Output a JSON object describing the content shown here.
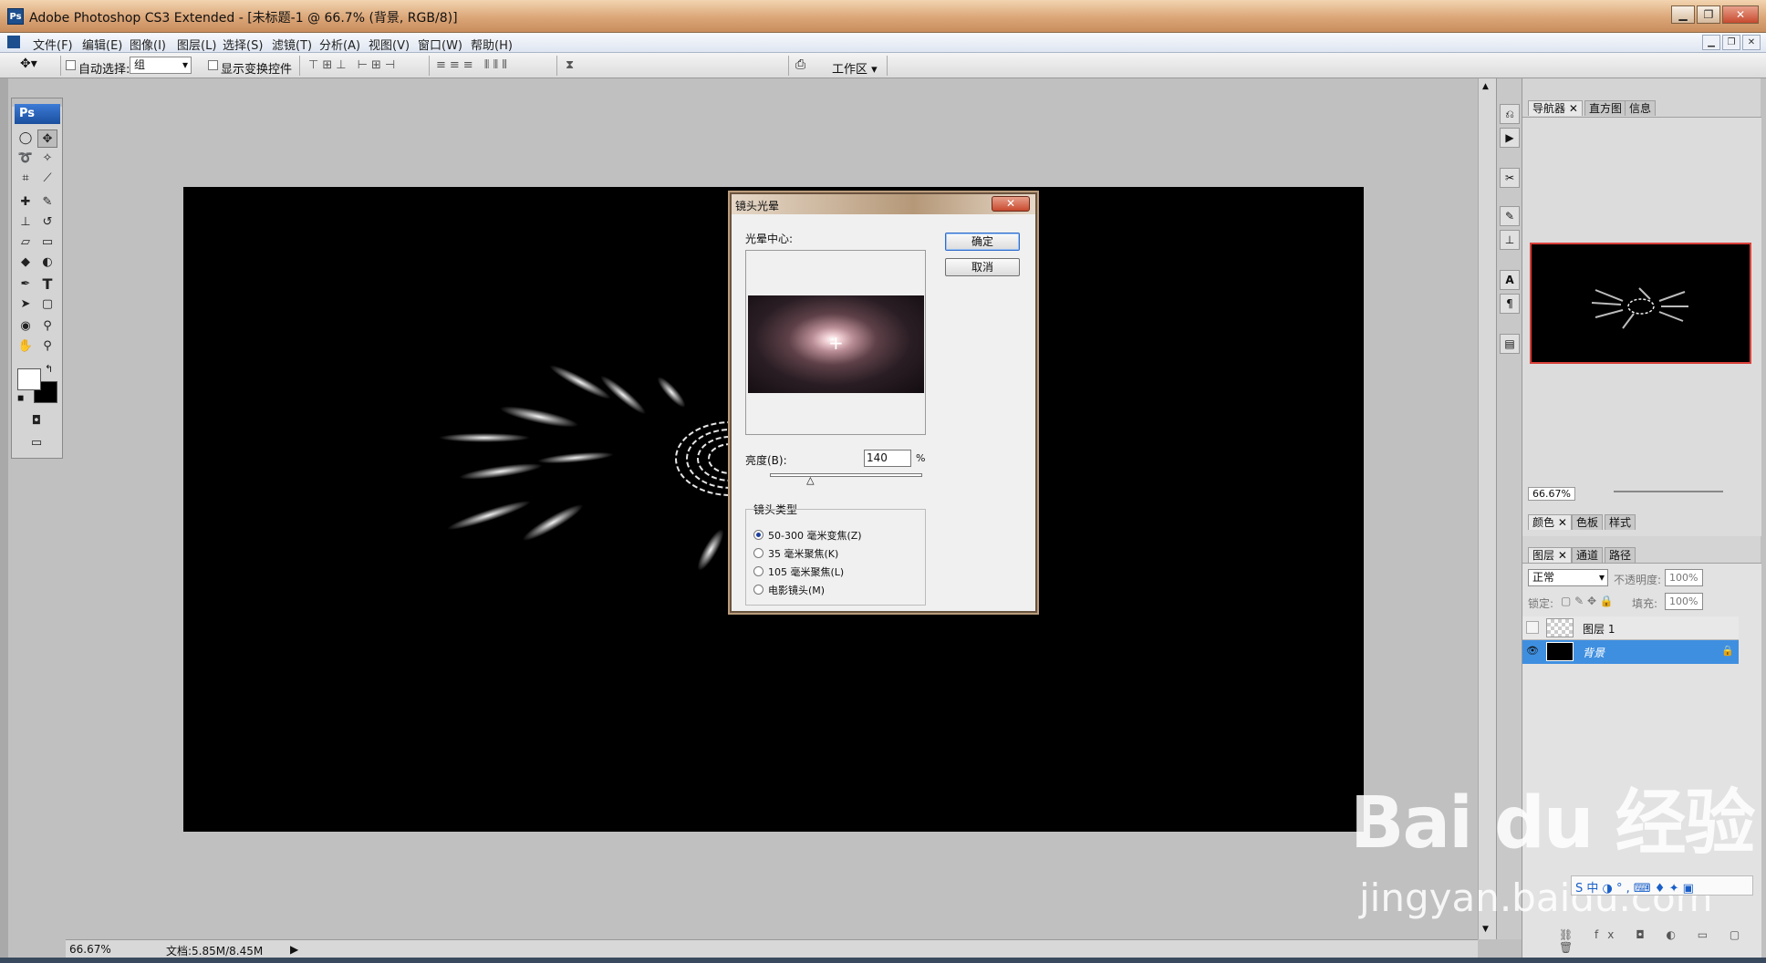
{
  "window": {
    "title": "Adobe Photoshop CS3 Extended - [未标题-1 @ 66.7% (背景, RGB/8)]",
    "app_icon": "Ps",
    "controls": [
      "▁",
      "❐",
      "✕"
    ]
  },
  "menu": {
    "items": [
      "文件(F)",
      "编辑(E)",
      "图像(I)",
      "图层(L)",
      "选择(S)",
      "滤镜(T)",
      "分析(A)",
      "视图(V)",
      "窗口(W)",
      "帮助(H)"
    ]
  },
  "options": {
    "auto_select_label": "自动选择:",
    "auto_select_value": "组",
    "show_transform_label": "显示变换控件",
    "workspace_label": "工作区 ▾"
  },
  "toolbox": {
    "logo": "Ps"
  },
  "status": {
    "zoom": "66.67%",
    "doc": "文档:5.85M/8.45M"
  },
  "dialog": {
    "title": "镜头光晕",
    "close": "✕",
    "center_label": "光晕中心:",
    "ok": "确定",
    "cancel": "取消",
    "brightness_label": "亮度(B):",
    "brightness_value": "140",
    "brightness_unit": "%",
    "brightness_fraction": 0.27,
    "lens_type_label": "镜头类型",
    "lens_options": [
      "50-300 毫米变焦(Z)",
      "35 毫米聚焦(K)",
      "105 毫米聚焦(L)",
      "电影镜头(M)"
    ],
    "selected_lens": 0
  },
  "navigator": {
    "tabs": [
      "导航器",
      "直方图",
      "信息"
    ],
    "zoom": "66.67%"
  },
  "color_panel": {
    "tabs": [
      "颜色",
      "色板",
      "样式"
    ]
  },
  "layers_panel": {
    "tabs": [
      "图层",
      "通道",
      "路径"
    ],
    "blend_mode": "正常",
    "opacity_label": "不透明度:",
    "opacity_value": "100%",
    "lock_label": "锁定:",
    "fill_label": "填充:",
    "fill_value": "100%",
    "layers": [
      {
        "name": "图层 1",
        "visible": false,
        "selected": false
      },
      {
        "name": "背景",
        "visible": true,
        "selected": true
      }
    ]
  },
  "watermark": {
    "line1": "Bai du 经验",
    "line2": "jingyan.baidu.com"
  },
  "ime": {
    "text": "S 中 ◑ ° , ⌨ ♦ ✦ ▣"
  }
}
